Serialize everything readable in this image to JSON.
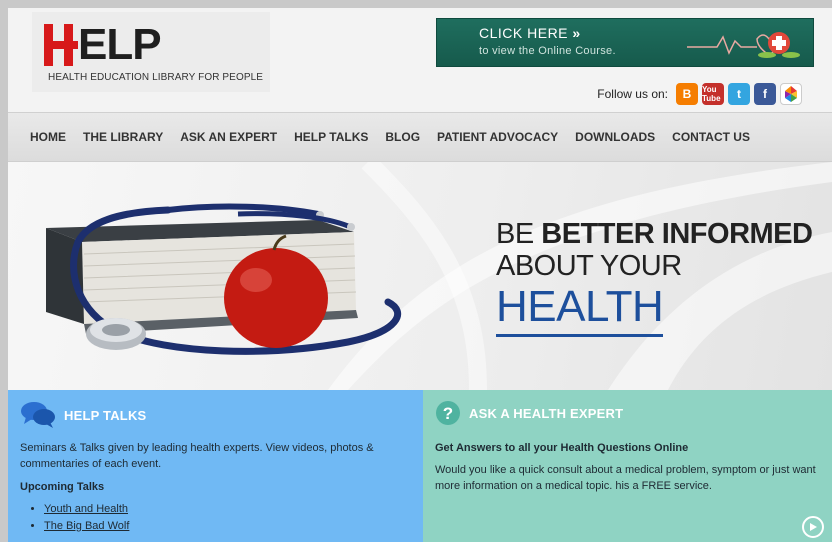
{
  "header": {
    "logo_letters": "ELP",
    "logo_subtitle": "HEALTH EDUCATION LIBRARY FOR PEOPLE",
    "banner": {
      "line1": "CLICK HERE",
      "arrow": "»",
      "line2": "to view the Online Course."
    },
    "follow_label": "Follow us on:",
    "social_icons": [
      "blogger-icon",
      "youtube-icon",
      "twitter-icon",
      "facebook-icon",
      "picasa-icon"
    ],
    "social_glyphs": {
      "blogger": "B",
      "youtube": "You Tube",
      "twitter": "t",
      "facebook": "f"
    }
  },
  "nav": {
    "items": [
      "HOME",
      "THE LIBRARY",
      "ASK AN EXPERT",
      "HELP TALKS",
      "BLOG",
      "PATIENT ADVOCACY",
      "DOWNLOADS",
      "CONTACT US"
    ]
  },
  "hero": {
    "line1_prefix": "BE ",
    "line1_bold": "BETTER INFORMED",
    "line2": "ABOUT YOUR",
    "line3": "HEALTH"
  },
  "panels": {
    "talks": {
      "title": "HELP TALKS",
      "description": "Seminars & Talks given by leading health experts. View videos, photos & commentaries of each event.",
      "upcoming_label": "Upcoming Talks",
      "items": [
        "Youth and Health",
        "The Big Bad Wolf"
      ]
    },
    "expert": {
      "icon_glyph": "?",
      "title": "ASK A HEALTH EXPERT",
      "subtitle": "Get Answers to all your Health Questions Online",
      "description": "Would you like a quick consult about a medical problem, symptom or just want more information on a medical topic. his a FREE service."
    }
  },
  "colors": {
    "logo_red": "#d7191a",
    "nav_bg": "#e4e4e4",
    "banner_green": "#1f6e5e",
    "health_blue": "#1d4f9c",
    "talks_blue": "#70b9f4",
    "expert_teal": "#8fd3c3"
  }
}
